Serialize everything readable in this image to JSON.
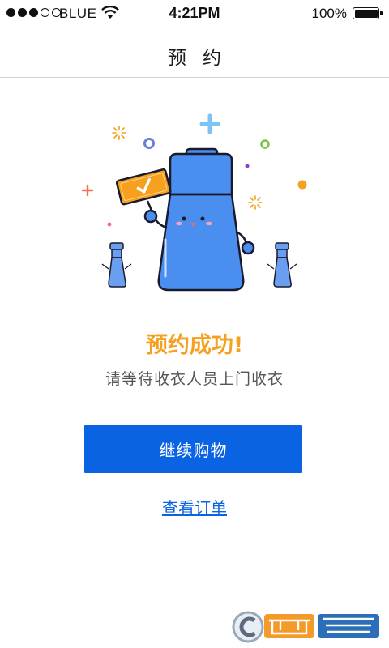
{
  "status_bar": {
    "carrier": "BLUE",
    "time": "4:21PM",
    "battery_percent": "100%",
    "signal_bars_filled": 3,
    "signal_bars_total": 5
  },
  "nav": {
    "title": "预约"
  },
  "main": {
    "success_title": "预约成功!",
    "success_subtitle": "请等待收衣人员上门收衣",
    "continue_button_label": "继续购物",
    "view_order_link": "查看订单"
  },
  "colors": {
    "primary_blue": "#0a63e3",
    "success_orange": "#f5a01e",
    "bottle_blue": "#4a8ff0"
  },
  "icons": {
    "wifi": "wifi-icon",
    "battery": "battery-icon",
    "illustration": "bottle-mascot-illustration",
    "watermark": "site-watermark-logo"
  }
}
